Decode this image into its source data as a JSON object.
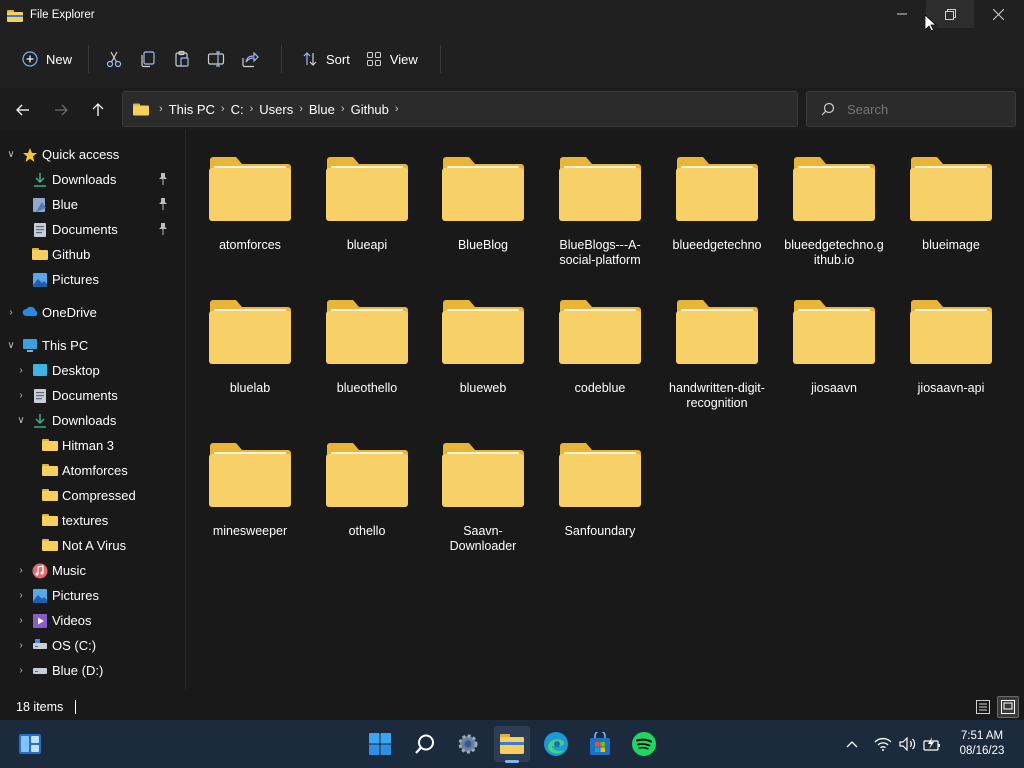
{
  "window": {
    "title": "File Explorer"
  },
  "toolbar": {
    "new_label": "New",
    "sort_label": "Sort",
    "view_label": "View"
  },
  "address": {
    "breadcrumbs": [
      "This PC",
      "C:",
      "Users",
      "Blue",
      "Github"
    ]
  },
  "search": {
    "placeholder": "Search"
  },
  "sidebar": {
    "quick_access": "Quick access",
    "quick_items": [
      {
        "label": "Downloads",
        "icon": "download-icon",
        "pinned": true
      },
      {
        "label": "Blue",
        "icon": "user-folder-icon",
        "pinned": true
      },
      {
        "label": "Documents",
        "icon": "documents-icon",
        "pinned": true
      },
      {
        "label": "Github",
        "icon": "folder-icon",
        "pinned": false
      },
      {
        "label": "Pictures",
        "icon": "pictures-icon",
        "pinned": false
      }
    ],
    "onedrive": "OneDrive",
    "this_pc": "This PC",
    "pc_items": [
      {
        "label": "Desktop",
        "icon": "desktop-icon"
      },
      {
        "label": "Documents",
        "icon": "documents-icon"
      },
      {
        "label": "Downloads",
        "icon": "download-icon"
      },
      {
        "label": "Hitman 3",
        "icon": "folder-icon"
      },
      {
        "label": "Atomforces",
        "icon": "folder-icon"
      },
      {
        "label": "Compressed",
        "icon": "folder-icon"
      },
      {
        "label": "textures",
        "icon": "folder-icon"
      },
      {
        "label": "Not A Virus",
        "icon": "folder-icon"
      },
      {
        "label": "Music",
        "icon": "music-icon"
      },
      {
        "label": "Pictures",
        "icon": "pictures-icon"
      },
      {
        "label": "Videos",
        "icon": "videos-icon"
      },
      {
        "label": "OS (C:)",
        "icon": "drive-c-icon"
      },
      {
        "label": "Blue (D:)",
        "icon": "drive-d-icon"
      }
    ]
  },
  "folders": [
    {
      "line1": "atomforces",
      "line2": ""
    },
    {
      "line1": "blueapi",
      "line2": ""
    },
    {
      "line1": "BlueBlog",
      "line2": ""
    },
    {
      "line1": "BlueBlogs---A-",
      "line2": "social-platform"
    },
    {
      "line1": "blueedgetechno",
      "line2": ""
    },
    {
      "line1": "blueedgetechno.g",
      "line2": "ithub.io"
    },
    {
      "line1": "blueimage",
      "line2": ""
    },
    {
      "line1": "bluelab",
      "line2": ""
    },
    {
      "line1": "blueothello",
      "line2": ""
    },
    {
      "line1": "blueweb",
      "line2": ""
    },
    {
      "line1": "codeblue",
      "line2": ""
    },
    {
      "line1": "handwritten-digit-",
      "line2": "recognition"
    },
    {
      "line1": "jiosaavn",
      "line2": ""
    },
    {
      "line1": "jiosaavn-api",
      "line2": ""
    },
    {
      "line1": "minesweeper",
      "line2": ""
    },
    {
      "line1": "othello",
      "line2": ""
    },
    {
      "line1": "Saavn-",
      "line2": "Downloader"
    },
    {
      "line1": "Sanfoundary",
      "line2": ""
    }
  ],
  "status": {
    "item_count": "18 items"
  },
  "taskbar": {
    "apps": [
      "widgets-icon",
      "start-icon",
      "search-icon",
      "settings-icon",
      "file-explorer-icon",
      "edge-icon",
      "store-icon",
      "spotify-icon"
    ],
    "time": "7:51 AM",
    "date": "08/16/23"
  },
  "colors": {
    "folder_back": "#e8b537",
    "folder_front": "#f7d068",
    "taskbar": "#1b2a3d",
    "window": "#202020"
  }
}
